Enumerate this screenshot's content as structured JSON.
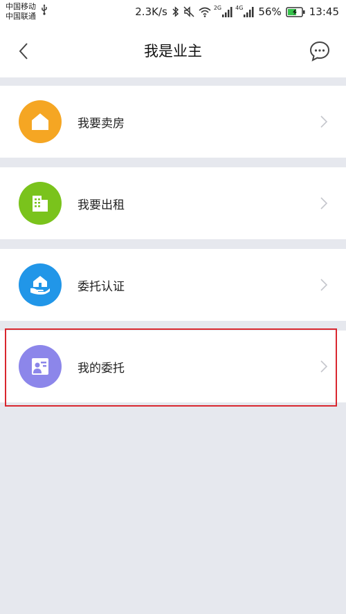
{
  "status_bar": {
    "carrier_1": "中国移动",
    "carrier_2": "中国联通",
    "net_speed": "2.3K/s",
    "net_type_1": "2G",
    "net_type_2": "4G",
    "battery": "56%",
    "time": "13:45"
  },
  "nav": {
    "title": "我是业主"
  },
  "menu": {
    "items": [
      {
        "label": "我要卖房",
        "icon": "house-icon",
        "color": "#f5a623"
      },
      {
        "label": "我要出租",
        "icon": "building-icon",
        "color": "#7ac31c"
      },
      {
        "label": "委托认证",
        "icon": "hand-house-icon",
        "color": "#2196e8"
      },
      {
        "label": "我的委托",
        "icon": "id-card-icon",
        "color": "#8c86ea"
      }
    ]
  }
}
